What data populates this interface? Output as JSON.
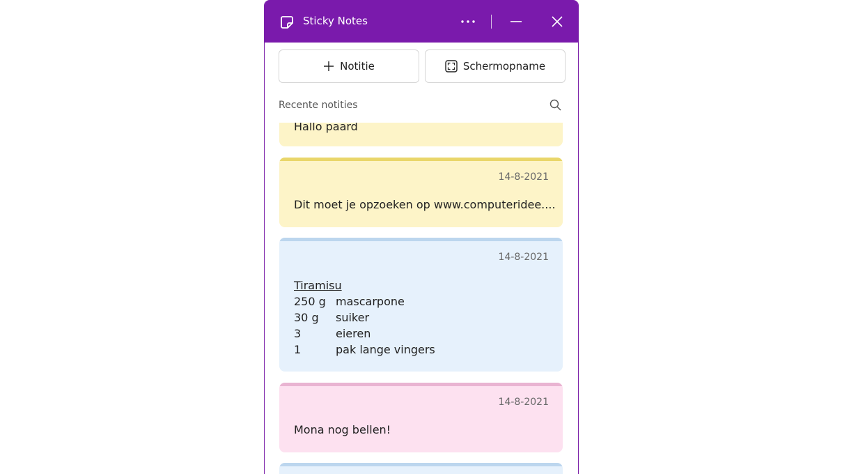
{
  "window": {
    "title": "Sticky Notes"
  },
  "toolbar": {
    "new_note_label": "Notitie",
    "screenshot_label": "Schermopname"
  },
  "list": {
    "recent_label": "Recente notities"
  },
  "notes": [
    {
      "date": "",
      "text": "Hallo paard",
      "color": "yellow"
    },
    {
      "date": "14-8-2021",
      "text": "Dit moet je opzoeken op www.computeridee....",
      "color": "yellow"
    },
    {
      "date": "14-8-2021",
      "heading": "Tiramisu",
      "rows": [
        {
          "qty": "250 g",
          "item": "mascarpone"
        },
        {
          "qty": "30 g",
          "item": "suiker"
        },
        {
          "qty": "3",
          "item": "eieren"
        },
        {
          "qty": "1",
          "item": "pak lange vingers"
        }
      ],
      "color": "blue"
    },
    {
      "date": "14-8-2021",
      "text": "Mona nog bellen!",
      "color": "pink"
    },
    {
      "date": "",
      "text": "",
      "color": "blue"
    }
  ],
  "colors": {
    "titlebar": "#7a1aac",
    "yellow": "#fdf4c8",
    "blue": "#e6f1fc",
    "pink": "#fde1f0"
  },
  "icons": [
    "sticky-notes-app-icon",
    "more-icon",
    "minimize-icon",
    "close-icon",
    "plus-icon",
    "screenshot-icon",
    "search-icon"
  ]
}
